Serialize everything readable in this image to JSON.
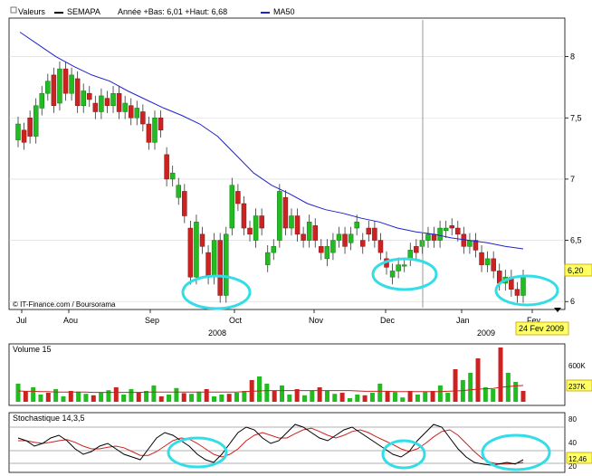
{
  "header": {
    "label_valeurs": "Valeurs",
    "ticker": "SEMAPA",
    "range_text": "Année +Bas: 6,01 +Haut: 6,68",
    "ma_label": "MA50"
  },
  "watermark": "© IT-Finance.com / Boursorama",
  "last_price_tag": "6,20",
  "date_tag": "24 Fev 2009",
  "colors": {
    "up": "#22bb22",
    "down": "#cc2222",
    "ma": "#2222cc",
    "circle": "#33dde8",
    "tag": "#ffff66",
    "grid": "#d8d8d8",
    "stoch_k": "#000000",
    "stoch_d": "#cc2222"
  },
  "chart_data": [
    {
      "type": "candlestick",
      "title": "SEMAPA",
      "x_axis": {
        "month_labels": [
          "Jul",
          "Aou",
          "Sep",
          "Oct",
          "Nov",
          "Dec",
          "Jan",
          "Fev"
        ],
        "year_labels": [
          "2008",
          "2009"
        ]
      },
      "y_axis": {
        "ticks": [
          "8",
          "7,5",
          "7",
          "6,5",
          "6"
        ],
        "ylim": [
          5.95,
          8.3
        ],
        "side": "right"
      },
      "series": [
        {
          "name": "MA50",
          "type": "line",
          "values": [
            8.2,
            8.1,
            8.0,
            7.92,
            7.85,
            7.8,
            7.72,
            7.65,
            7.58,
            7.52,
            7.45,
            7.35,
            7.2,
            7.05,
            6.95,
            6.88,
            6.8,
            6.75,
            6.72,
            6.68,
            6.65,
            6.6,
            6.57,
            6.55,
            6.52,
            6.5,
            6.48,
            6.45,
            6.43
          ]
        }
      ],
      "candles": [
        [
          7.32,
          7.45
        ],
        [
          7.4,
          7.3
        ],
        [
          7.5,
          7.35
        ],
        [
          7.35,
          7.6
        ],
        [
          7.58,
          7.7
        ],
        [
          7.7,
          7.8
        ],
        [
          7.85,
          7.6
        ],
        [
          7.62,
          7.9
        ],
        [
          7.9,
          7.7
        ],
        [
          7.7,
          7.85
        ],
        [
          7.82,
          7.6
        ],
        [
          7.6,
          7.72
        ],
        [
          7.7,
          7.65
        ],
        [
          7.62,
          7.55
        ],
        [
          7.55,
          7.68
        ],
        [
          7.66,
          7.6
        ],
        [
          7.6,
          7.7
        ],
        [
          7.7,
          7.55
        ],
        [
          7.55,
          7.62
        ],
        [
          7.6,
          7.5
        ],
        [
          7.5,
          7.58
        ],
        [
          7.55,
          7.45
        ],
        [
          7.45,
          7.3
        ],
        [
          7.3,
          7.5
        ],
        [
          7.5,
          7.4
        ],
        [
          7.2,
          7.0
        ],
        [
          7.0,
          7.05
        ],
        [
          6.85,
          6.95
        ],
        [
          6.9,
          6.7
        ],
        [
          6.6,
          6.2
        ],
        [
          6.2,
          6.65
        ],
        [
          6.55,
          6.45
        ],
        [
          6.4,
          6.2
        ],
        [
          6.2,
          6.5
        ],
        [
          6.5,
          6.05
        ],
        [
          6.05,
          6.55
        ],
        [
          6.6,
          6.95
        ],
        [
          6.9,
          6.8
        ],
        [
          6.8,
          6.6
        ],
        [
          6.6,
          6.55
        ],
        [
          6.5,
          6.7
        ],
        [
          6.7,
          6.6
        ],
        [
          6.3,
          6.4
        ],
        [
          6.4,
          6.45
        ],
        [
          6.5,
          6.9
        ],
        [
          6.85,
          6.6
        ],
        [
          6.6,
          6.7
        ],
        [
          6.7,
          6.55
        ],
        [
          6.55,
          6.5
        ],
        [
          6.5,
          6.65
        ],
        [
          6.62,
          6.5
        ],
        [
          6.45,
          6.4
        ],
        [
          6.35,
          6.45
        ],
        [
          6.4,
          6.5
        ],
        [
          6.5,
          6.55
        ],
        [
          6.55,
          6.45
        ],
        [
          6.48,
          6.55
        ],
        [
          6.6,
          6.65
        ],
        [
          6.5,
          6.45
        ],
        [
          6.6,
          6.55
        ],
        [
          6.6,
          6.5
        ],
        [
          6.5,
          6.4
        ],
        [
          6.35,
          6.28
        ],
        [
          6.2,
          6.25
        ],
        [
          6.25,
          6.3
        ],
        [
          6.3,
          6.3
        ],
        [
          6.35,
          6.42
        ],
        [
          6.45,
          6.4
        ],
        [
          6.45,
          6.5
        ],
        [
          6.5,
          6.55
        ],
        [
          6.55,
          6.5
        ],
        [
          6.5,
          6.6
        ],
        [
          6.58,
          6.6
        ],
        [
          6.62,
          6.6
        ],
        [
          6.6,
          6.55
        ],
        [
          6.55,
          6.45
        ],
        [
          6.45,
          6.5
        ],
        [
          6.5,
          6.42
        ],
        [
          6.4,
          6.3
        ],
        [
          6.3,
          6.35
        ],
        [
          6.35,
          6.25
        ],
        [
          6.25,
          6.15
        ],
        [
          6.15,
          6.2
        ],
        [
          6.2,
          6.1
        ],
        [
          6.1,
          6.05
        ],
        [
          6.05,
          6.2
        ]
      ]
    },
    {
      "type": "bar",
      "title": "Volume 15",
      "y_axis": {
        "ticks": [
          "600K",
          "237K"
        ],
        "side": "right"
      },
      "values": [
        50,
        30,
        40,
        20,
        25,
        35,
        15,
        30,
        28,
        22,
        18,
        25,
        32,
        40,
        20,
        35,
        27,
        30,
        45,
        15,
        20,
        38,
        24,
        22,
        28,
        35,
        15,
        20,
        22,
        25,
        30,
        60,
        70,
        50,
        30,
        45,
        20,
        35,
        18,
        30,
        40,
        30,
        22,
        25,
        10,
        20,
        18,
        25,
        50,
        30,
        27,
        12,
        30,
        20,
        28,
        30,
        45,
        25,
        90,
        60,
        80,
        120,
        40,
        35,
        150,
        80,
        55,
        30
      ],
      "ma_values": [
        30,
        29,
        29,
        28,
        28,
        27,
        27,
        27,
        27,
        27,
        26,
        26,
        26,
        26,
        26,
        26,
        26,
        27,
        27,
        27,
        27,
        27,
        27,
        27,
        27,
        27,
        27,
        27,
        27,
        27,
        28,
        29,
        30,
        31,
        31,
        31,
        31,
        31,
        31,
        31,
        31,
        31,
        31,
        31,
        31,
        30,
        29,
        29,
        29,
        29,
        28,
        28,
        28,
        28,
        28,
        28,
        28,
        29,
        30,
        31,
        33,
        35,
        36,
        37,
        40,
        42,
        44,
        45
      ]
    },
    {
      "type": "line",
      "title": "Stochastique 14,3,5",
      "y_axis": {
        "ticks": [
          "80",
          "40",
          "20"
        ],
        "ylim": [
          0,
          100
        ],
        "side": "right"
      },
      "last_value_tag": "12,46",
      "series": [
        {
          "name": "K",
          "values": [
            60,
            55,
            45,
            50,
            60,
            65,
            55,
            40,
            30,
            35,
            45,
            50,
            40,
            30,
            25,
            20,
            40,
            60,
            70,
            65,
            55,
            45,
            30,
            20,
            15,
            30,
            50,
            70,
            80,
            75,
            60,
            50,
            55,
            70,
            85,
            80,
            70,
            60,
            55,
            65,
            75,
            80,
            70,
            60,
            50,
            40,
            30,
            25,
            35,
            55,
            70,
            85,
            80,
            60,
            40,
            25,
            15,
            12,
            10,
            12,
            15,
            12,
            20
          ]
        },
        {
          "name": "D",
          "values": [
            55,
            55,
            52,
            50,
            52,
            55,
            57,
            52,
            45,
            40,
            40,
            43,
            45,
            42,
            35,
            28,
            28,
            35,
            45,
            55,
            60,
            58,
            50,
            40,
            30,
            25,
            30,
            40,
            55,
            65,
            70,
            65,
            60,
            60,
            68,
            75,
            78,
            72,
            65,
            60,
            65,
            72,
            75,
            70,
            62,
            55,
            48,
            40,
            35,
            40,
            50,
            62,
            72,
            75,
            65,
            50,
            35,
            22,
            15,
            12,
            12,
            13,
            15
          ]
        }
      ]
    }
  ],
  "annotations": {
    "circles": [
      "sep-low",
      "dec-low",
      "fev-low",
      "stoch-1",
      "stoch-2",
      "stoch-3"
    ]
  }
}
